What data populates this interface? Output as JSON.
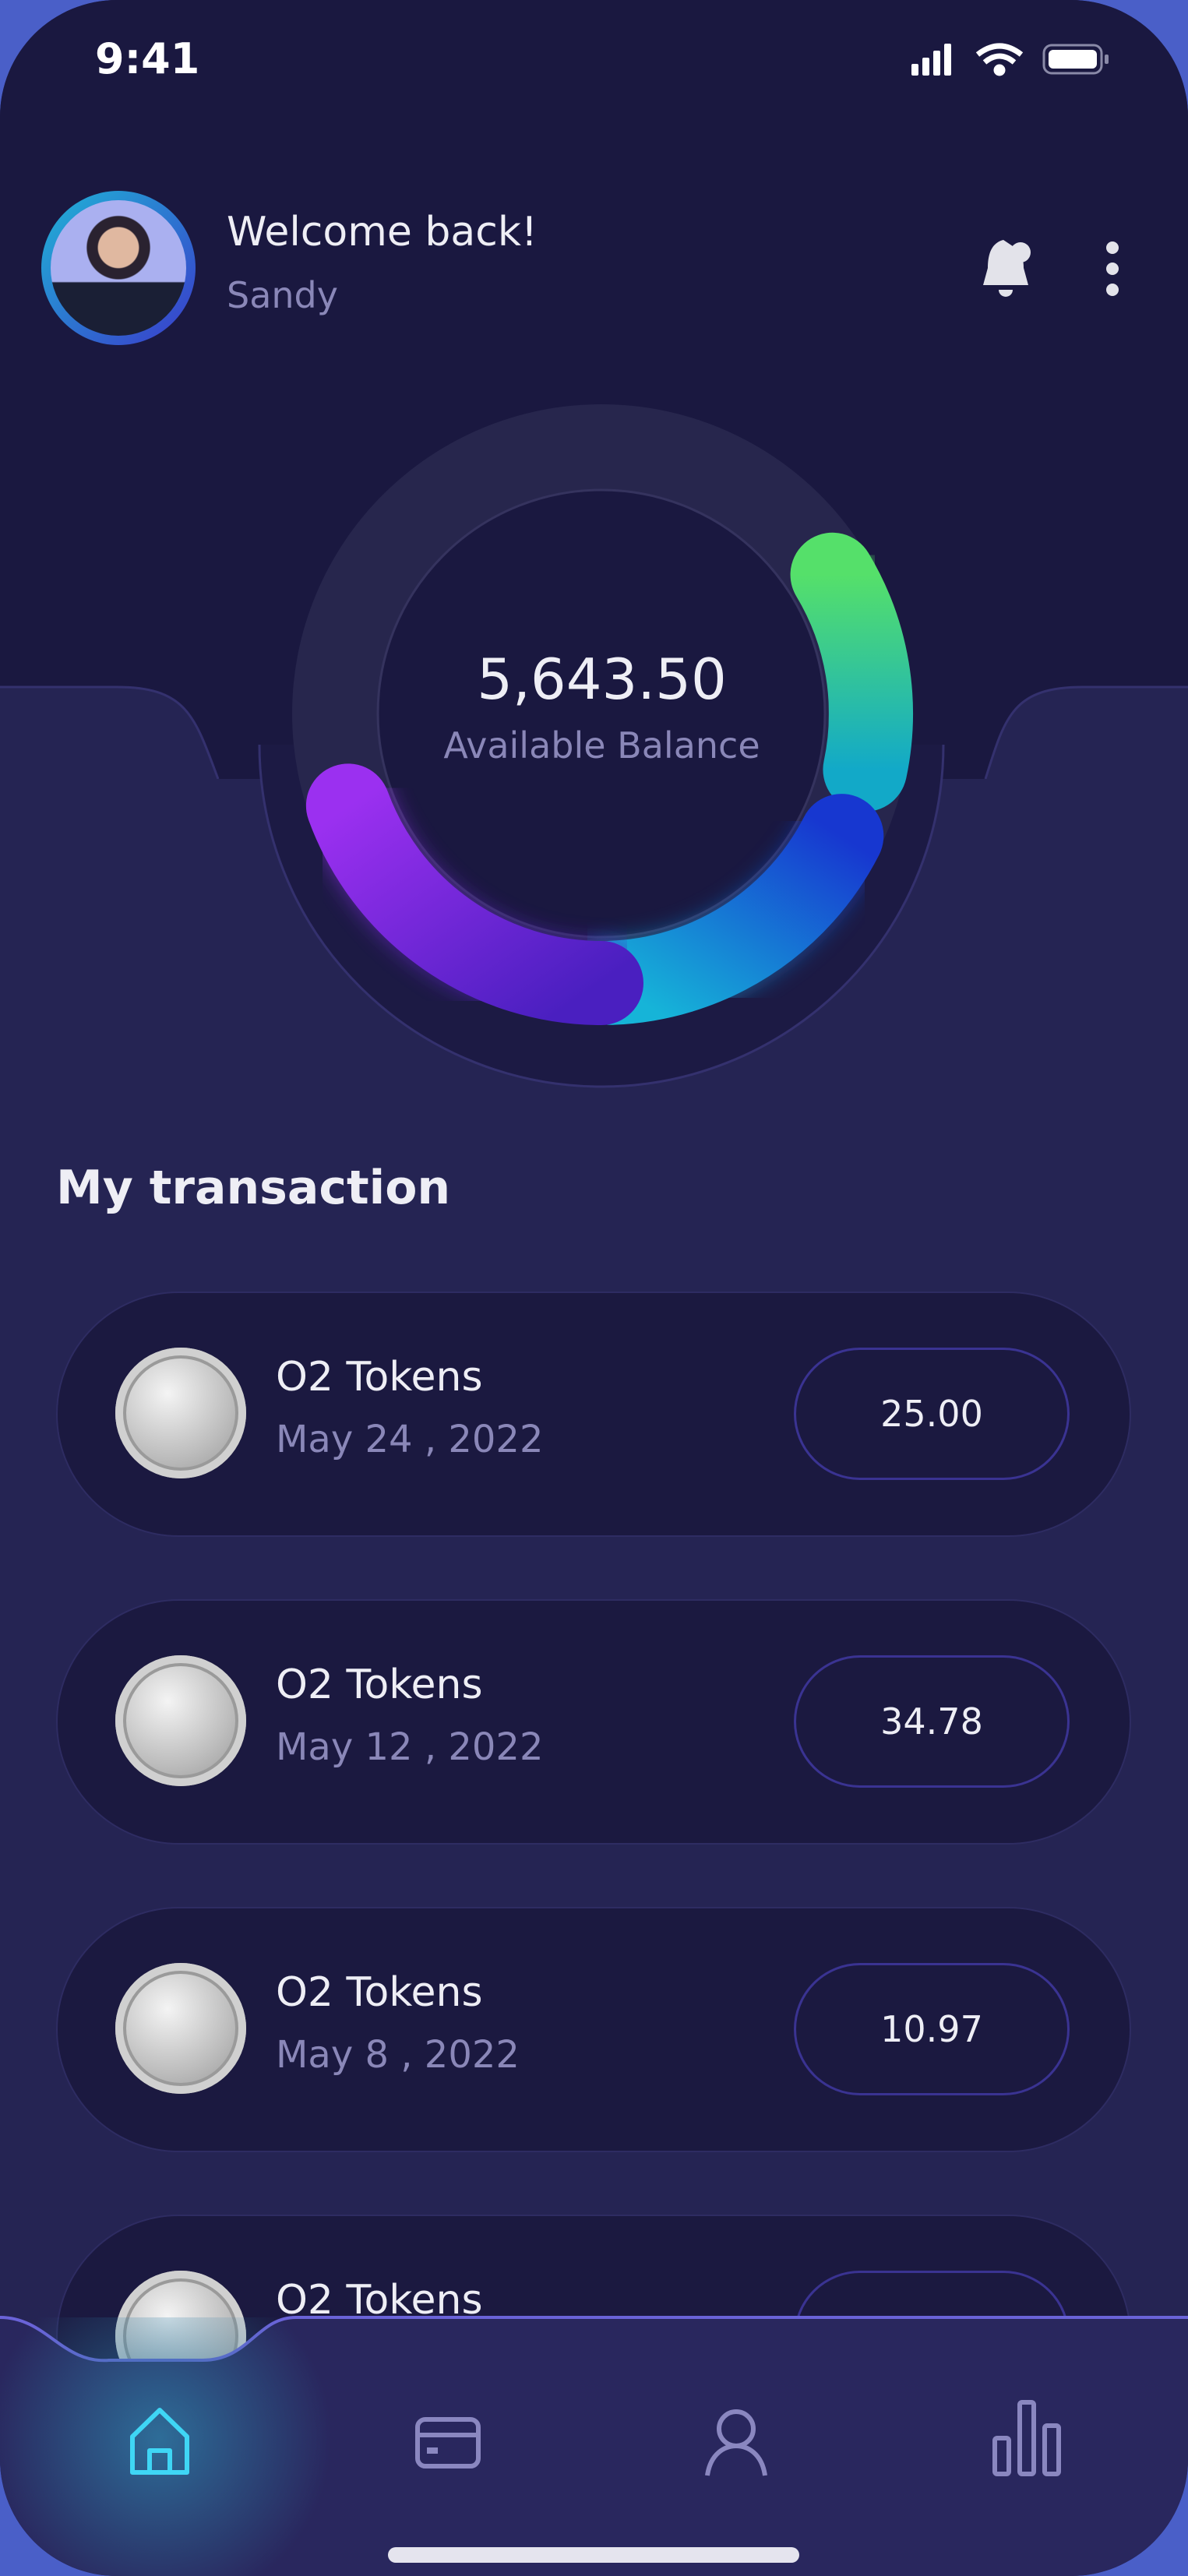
{
  "status_bar": {
    "time": "9:41",
    "icons": [
      "signal-icon",
      "wifi-icon",
      "battery-icon"
    ]
  },
  "header": {
    "greeting": "Welcome back!",
    "user_name": "Sandy",
    "icons": [
      "bell-icon",
      "more-vertical-icon"
    ]
  },
  "balance": {
    "amount": "5,643.50",
    "label": "Available Balance",
    "ring_colors": [
      "#8a2be2",
      "#1aa9d6",
      "#4fe07a"
    ]
  },
  "transactions": {
    "title": "My transaction",
    "items": [
      {
        "name": "O2 Tokens",
        "date": "May 24 , 2022",
        "amount": "25.00"
      },
      {
        "name": "O2 Tokens",
        "date": "May 12 , 2022",
        "amount": "34.78"
      },
      {
        "name": "O2 Tokens",
        "date": "May 8 , 2022",
        "amount": "10.97"
      },
      {
        "name": "O2 Tokens",
        "date": "",
        "amount": ""
      }
    ]
  },
  "nav": {
    "items": [
      "home-icon",
      "card-icon",
      "profile-icon",
      "stats-icon"
    ],
    "active": "home-icon",
    "active_color": "#3fd6f5",
    "inactive_color": "#8a87c0"
  }
}
